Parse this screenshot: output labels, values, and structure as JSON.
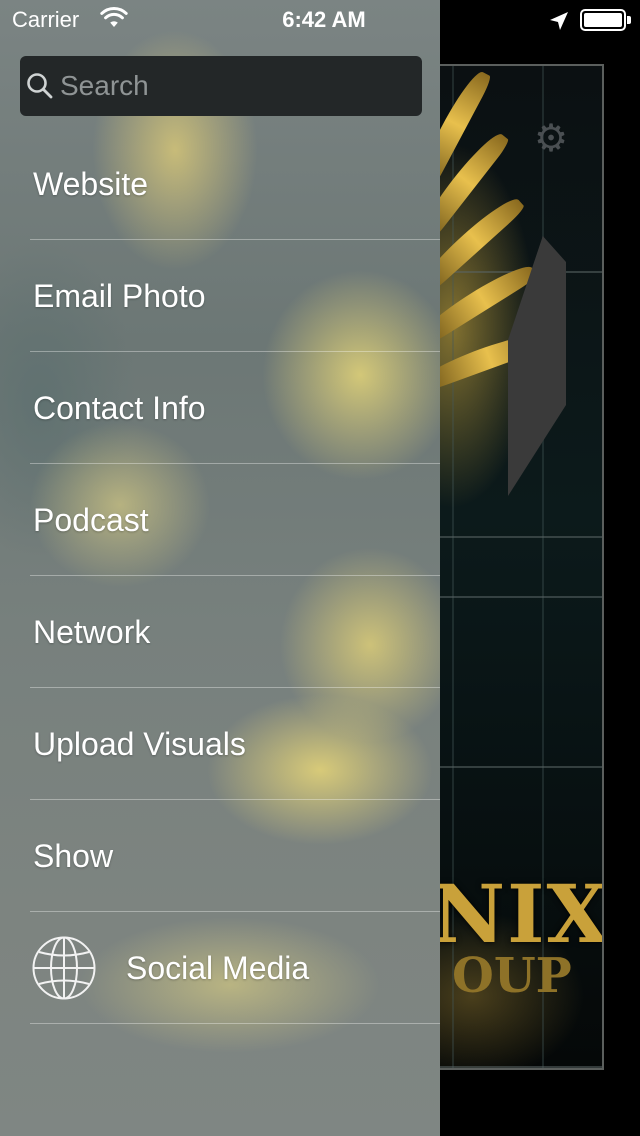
{
  "status_bar": {
    "carrier": "Carrier",
    "time": "6:42 AM",
    "wifi_icon": "wifi-icon",
    "location_icon": "location-arrow-icon",
    "battery_icon": "battery-full-icon"
  },
  "search": {
    "placeholder": "Search",
    "value": "",
    "icon": "search-icon"
  },
  "menu": {
    "items": [
      {
        "label": "Website"
      },
      {
        "label": "Email Photo"
      },
      {
        "label": "Contact Info"
      },
      {
        "label": "Podcast"
      },
      {
        "label": "Network"
      },
      {
        "label": "Upload Visuals"
      },
      {
        "label": "Show"
      },
      {
        "label": "Social Media",
        "icon": "globe-icon"
      }
    ]
  },
  "background_app": {
    "settings_icon": "gear-icon",
    "brand_text": "NIX",
    "brand_subtext": "OUP"
  },
  "colors": {
    "search_background": "#232728",
    "text": "#ffffff",
    "brand_gold": "#c9a13a"
  }
}
